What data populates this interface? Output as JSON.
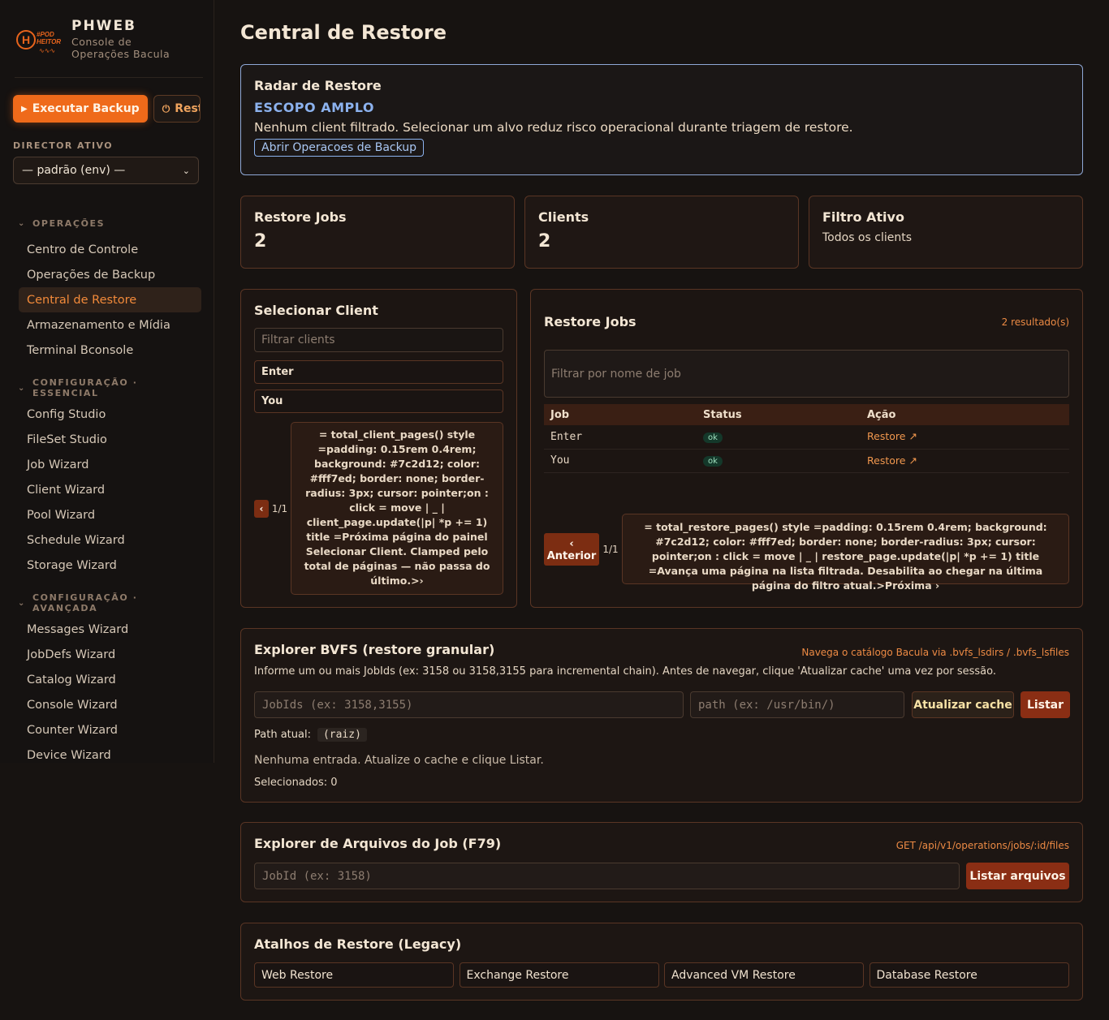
{
  "brand": {
    "name": "PHWEB",
    "subtitle": "Console de Operações Bacula",
    "logo_letter": "H",
    "logo_tag": "#POD HEITOR"
  },
  "sidebar": {
    "exec_backup_label": "Executar Backup",
    "restore_label": "Restaurar",
    "director_label": "DIRECTOR ATIVO",
    "director_value": "— padrão (env) —",
    "sections": [
      {
        "title": "OPERAÇÕES",
        "items": [
          "Centro de Controle",
          "Operações de Backup",
          "Central de Restore",
          "Armazenamento e Mídia",
          "Terminal Bconsole"
        ]
      },
      {
        "title": "CONFIGURAÇÃO · ESSENCIAL",
        "items": [
          "Config Studio",
          "FileSet Studio",
          "Job Wizard",
          "Client Wizard",
          "Pool Wizard",
          "Schedule Wizard",
          "Storage Wizard"
        ]
      },
      {
        "title": "CONFIGURAÇÃO · AVANÇADA",
        "items": [
          "Messages Wizard",
          "JobDefs Wizard",
          "Catalog Wizard",
          "Console Wizard",
          "Counter Wizard",
          "Device Wizard"
        ]
      }
    ],
    "active_item": "Central de Restore"
  },
  "page": {
    "title": "Central de Restore"
  },
  "radar": {
    "title": "Radar de Restore",
    "scope": "ESCOPO AMPLO",
    "message": "Nenhum client filtrado. Selecionar um alvo reduz risco operacional durante triagem de restore.",
    "link_label": "Abrir Operacoes de Backup"
  },
  "stats": {
    "restore_jobs_label": "Restore Jobs",
    "restore_jobs_value": "2",
    "clients_label": "Clients",
    "clients_value": "2",
    "filter_label": "Filtro Ativo",
    "filter_value": "Todos os clients"
  },
  "select_client": {
    "title": "Selecionar Client",
    "filter_placeholder": "Filtrar clients",
    "clients": [
      "Enter",
      "You"
    ],
    "prev_label": "‹",
    "page_count": "1/1",
    "raw_next": "= total_client_pages() style =padding: 0.15rem 0.4rem; background: #7c2d12; color: #fff7ed; border: none; border-radius: 3px; cursor: pointer;on : click = move | _ | client_page.update(|p| *p += 1) title =Próxima página do painel Selecionar Client. Clamped pelo total de páginas — não passa do último.>›"
  },
  "restore_jobs": {
    "title": "Restore Jobs",
    "result_count": "2 resultado(s)",
    "filter_placeholder": "Filtrar por nome de job",
    "columns": [
      "Job",
      "Status",
      "Ação"
    ],
    "rows": [
      {
        "job": "Enter",
        "status": "ok",
        "action": "Restore ↗"
      },
      {
        "job": "You",
        "status": "ok",
        "action": "Restore ↗"
      }
    ],
    "prev_label": "‹ Anterior",
    "page_count": "1/1",
    "raw_next": "= total_restore_pages() style =padding: 0.15rem 0.4rem; background: #7c2d12; color: #fff7ed; border: none; border-radius: 3px; cursor: pointer;on : click = move | _ | restore_page.update(|p| *p += 1) title =Avança uma página na lista filtrada. Desabilita ao chegar na última página do filtro atual.>Próxima ›"
  },
  "bvfs": {
    "title": "Explorer BVFS (restore granular)",
    "hint": "Navega o catálogo Bacula via .bvfs_lsdirs / .bvfs_lsfiles",
    "description": "Informe um ou mais JobIds (ex: 3158 ou 3158,3155 para incremental chain). Antes de navegar, clique 'Atualizar cache' uma vez por sessão.",
    "jobids_placeholder": "JobIds (ex: 3158,3155)",
    "path_placeholder": "path (ex: /usr/bin/)",
    "cache_label": "Atualizar cache",
    "list_label": "Listar",
    "path_label": "Path atual:",
    "path_value": "(raiz)",
    "empty_message": "Nenhuma entrada. Atualize o cache e clique Listar.",
    "selected_label": "Selecionados: 0"
  },
  "f79": {
    "title": "Explorer de Arquivos do Job (F79)",
    "hint": "GET /api/v1/operations/jobs/:id/files",
    "jobid_placeholder": "JobId (ex: 3158)",
    "list_label": "Listar arquivos"
  },
  "legacy": {
    "title": "Atalhos de Restore (Legacy)",
    "shortcuts": [
      "Web Restore",
      "Exchange Restore",
      "Advanced VM Restore",
      "Database Restore"
    ]
  }
}
